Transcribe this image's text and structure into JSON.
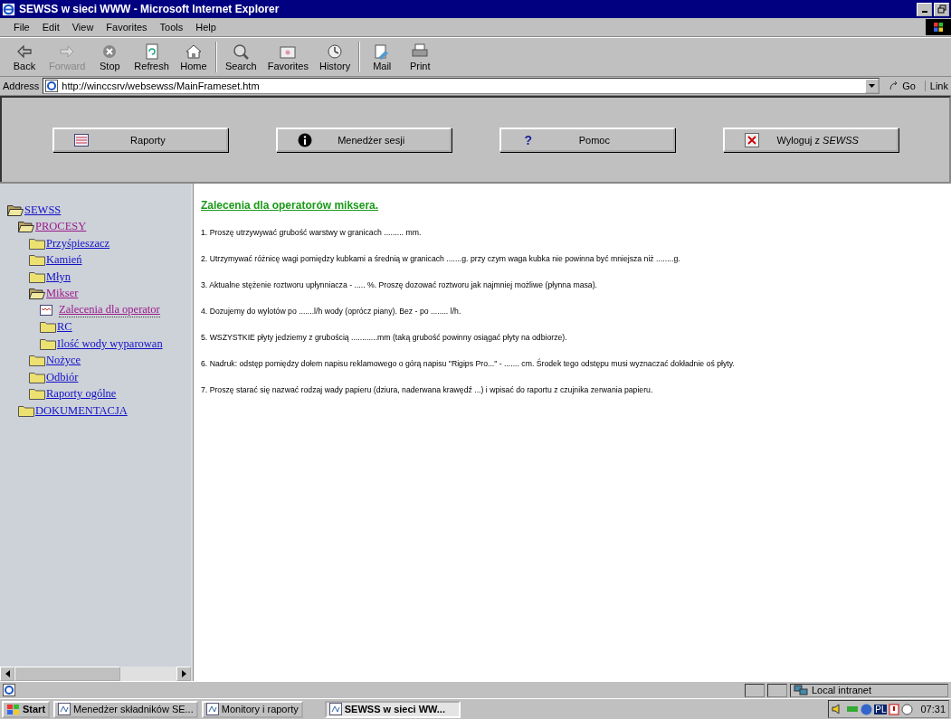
{
  "window": {
    "title": "SEWSS w sieci WWW - Microsoft Internet Explorer"
  },
  "menu": [
    "File",
    "Edit",
    "View",
    "Favorites",
    "Tools",
    "Help"
  ],
  "toolbar": [
    {
      "label": "Back",
      "disabled": false
    },
    {
      "label": "Forward",
      "disabled": true
    },
    {
      "label": "Stop",
      "disabled": false
    },
    {
      "label": "Refresh",
      "disabled": false
    },
    {
      "label": "Home",
      "disabled": false
    },
    {
      "label": "Search",
      "disabled": false
    },
    {
      "label": "Favorites",
      "disabled": false
    },
    {
      "label": "History",
      "disabled": false
    },
    {
      "label": "Mail",
      "disabled": false
    },
    {
      "label": "Print",
      "disabled": false
    }
  ],
  "address": {
    "label": "Address",
    "value": "http://winccsrv/websewss/MainFrameset.htm",
    "go": "Go",
    "links": "Link"
  },
  "top_buttons": [
    {
      "kind": "report",
      "label": "Raporty"
    },
    {
      "kind": "info",
      "label": "Menedżer sesji"
    },
    {
      "kind": "help",
      "icon": "?",
      "label": "Pomoc"
    },
    {
      "kind": "logout",
      "label": "Wyloguj z *SEWSS*"
    }
  ],
  "sidebar": {
    "tree": [
      {
        "label": "SEWSS",
        "kind": "folder",
        "expanded": true,
        "active": false,
        "children": [
          {
            "label": "PROCESY",
            "kind": "folder",
            "expanded": true,
            "active": true,
            "children": [
              {
                "label": "Przyśpieszacz",
                "kind": "folder",
                "expanded": false,
                "active": false
              },
              {
                "label": "Kamień",
                "kind": "folder",
                "expanded": false,
                "active": false
              },
              {
                "label": "Młyn",
                "kind": "folder",
                "expanded": false,
                "active": false
              },
              {
                "label": "Mikser",
                "kind": "folder",
                "expanded": true,
                "active": true,
                "children": [
                  {
                    "label": "Zalecenia dla operator",
                    "kind": "page",
                    "active": true
                  },
                  {
                    "label": "RC",
                    "kind": "folder",
                    "expanded": false,
                    "active": false
                  },
                  {
                    "label": "Ilość wody wyparowan",
                    "kind": "folder",
                    "expanded": false,
                    "active": false
                  }
                ]
              },
              {
                "label": "Nożyce",
                "kind": "folder",
                "expanded": false,
                "active": false
              },
              {
                "label": "Odbiór",
                "kind": "folder",
                "expanded": false,
                "active": false
              },
              {
                "label": "Raporty ogólne",
                "kind": "folder",
                "expanded": false,
                "active": false
              }
            ]
          },
          {
            "label": "DOKUMENTACJA",
            "kind": "folder",
            "expanded": false,
            "active": false
          }
        ]
      }
    ]
  },
  "content": {
    "heading": "Zalecenia dla operatorów miksera.",
    "items": [
      "1. Proszę utrzywywać grubość warstwy w granicach ......... mm.",
      "2. Utrzymywać różnicę wagi pomiędzy kubkami a średnią w granicach .......g. przy czym waga kubka nie powinna być mniejsza niż ........g.",
      "3. Aktualne stężenie roztworu upłynniacza - ..... %. Proszę dozować roztworu jak najmniej możliwe (płynna masa).",
      "4. Dozujemy do wylotów po .......l/h wody (oprócz piany). Bez - po ........ l/h.",
      "5. WSZYSTKIE płyty jedziemy z grubością ............mm (taką grubość powinny osiągać płyty na odbiorze).",
      "6. Nadruk: odstęp pomiędzy dołem napisu reklamowego o górą napisu \"Rigips Pro...\" - ....... cm. Środek tego odstępu musi wyznaczać dokładnie oś płyty.",
      "7. Proszę starać się nazwać rodzaj wady papieru (dziura, naderwana krawędź ...) i wpisać do raportu z czujnika zerwania papieru."
    ]
  },
  "status_bar": {
    "zone": "Local intranet"
  },
  "taskbar": {
    "start": "Start",
    "tasks": [
      {
        "label": "Menedżer składników SE...",
        "selected": false
      },
      {
        "label": "Monitory i raporty",
        "selected": false
      },
      {
        "label": "SEWSS w sieci WW...",
        "selected": true
      }
    ],
    "lang": "PL",
    "clock": "07:31"
  }
}
